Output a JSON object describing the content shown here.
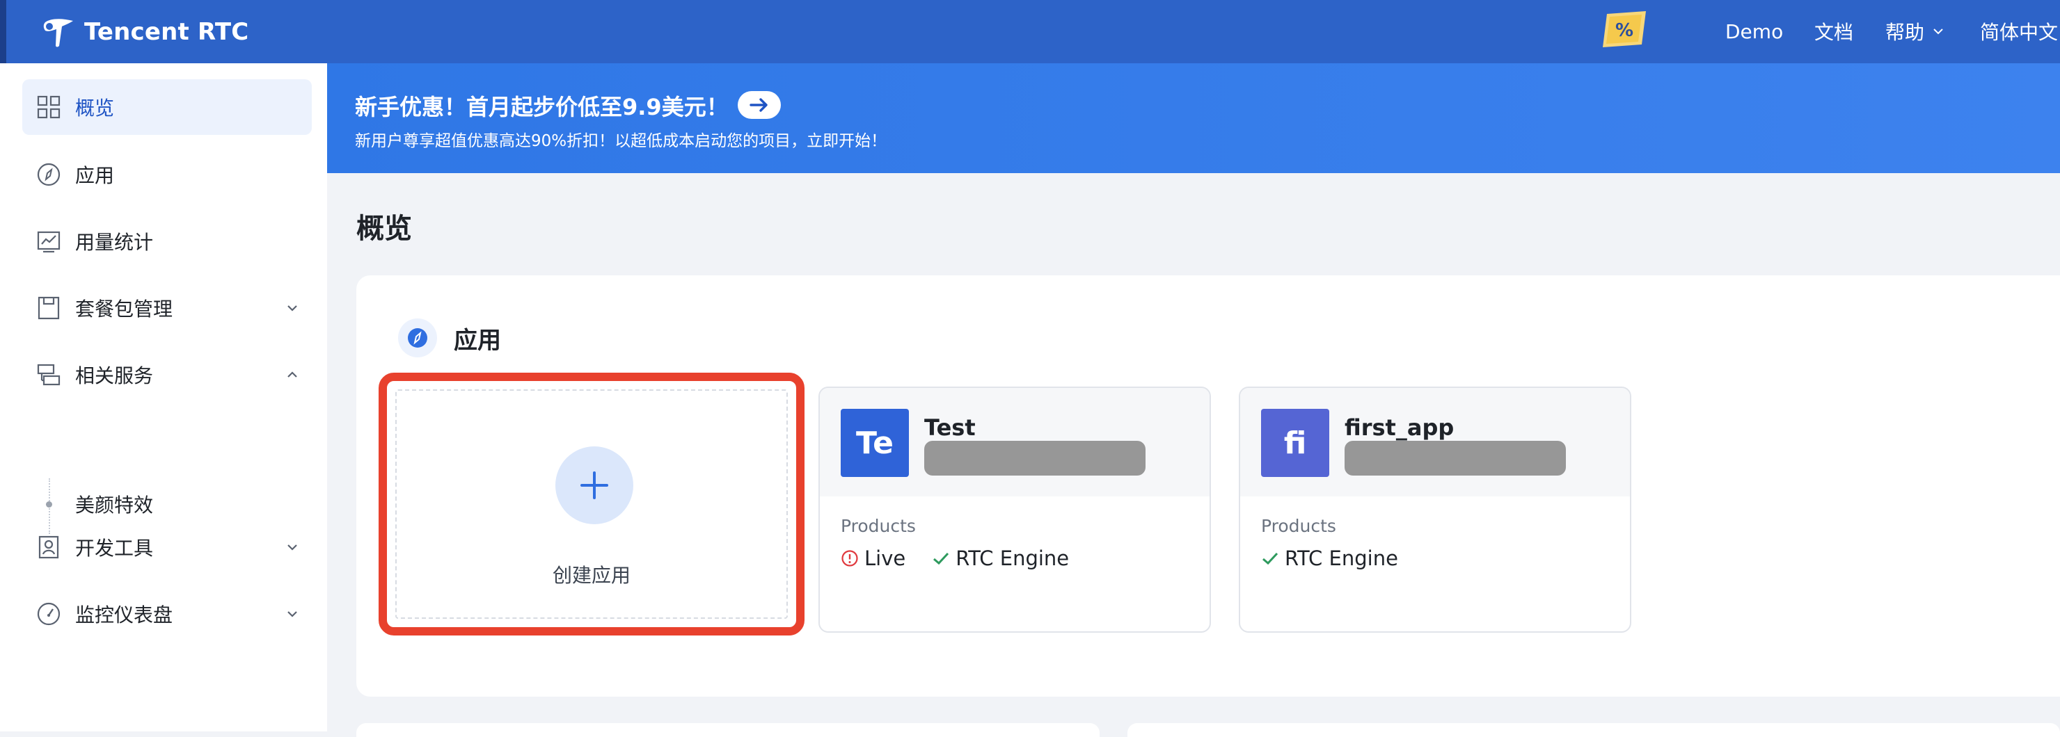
{
  "header": {
    "brand": "Tencent RTC",
    "nav": [
      {
        "label": "Demo"
      },
      {
        "label": "文档"
      },
      {
        "label": "帮助"
      },
      {
        "label": "简体中文"
      }
    ]
  },
  "sidebar": {
    "items": [
      {
        "label": "概览",
        "icon": "grid-icon",
        "active": true
      },
      {
        "label": "应用",
        "icon": "compass-icon"
      },
      {
        "label": "用量统计",
        "icon": "chart-icon"
      },
      {
        "label": "套餐包管理",
        "icon": "package-icon"
      },
      {
        "label": "相关服务",
        "icon": "services-icon"
      },
      {
        "label": "开发工具",
        "icon": "badge-icon"
      },
      {
        "label": "监控仪表盘",
        "icon": "gauge-icon"
      }
    ],
    "sub_item": "美颜特效"
  },
  "banner": {
    "title": "新手优惠！首月起步价低至9.9美元！",
    "subtitle": "新用户尊享超值优惠高达90%折扣！以超低成本启动您的项目，立即开始！"
  },
  "page": {
    "title": "概览"
  },
  "apps_panel": {
    "title": "应用",
    "create_label": "创建应用",
    "products_label": "Products",
    "cards": [
      {
        "avatar": "Te",
        "name": "Test",
        "avatar_color": "#2f63d8",
        "products": [
          {
            "name": "Live",
            "status": "warning"
          },
          {
            "name": "RTC Engine",
            "status": "ok"
          }
        ]
      },
      {
        "avatar": "fi",
        "name": "first_app",
        "avatar_color": "#5565d4",
        "products": [
          {
            "name": "RTC Engine",
            "status": "ok"
          }
        ]
      }
    ]
  },
  "colors": {
    "topbar": "#2d63c8",
    "accent": "#1f54c4",
    "highlight": "#e8412d",
    "ok": "#2e9a5e",
    "warning": "#e0393e"
  }
}
